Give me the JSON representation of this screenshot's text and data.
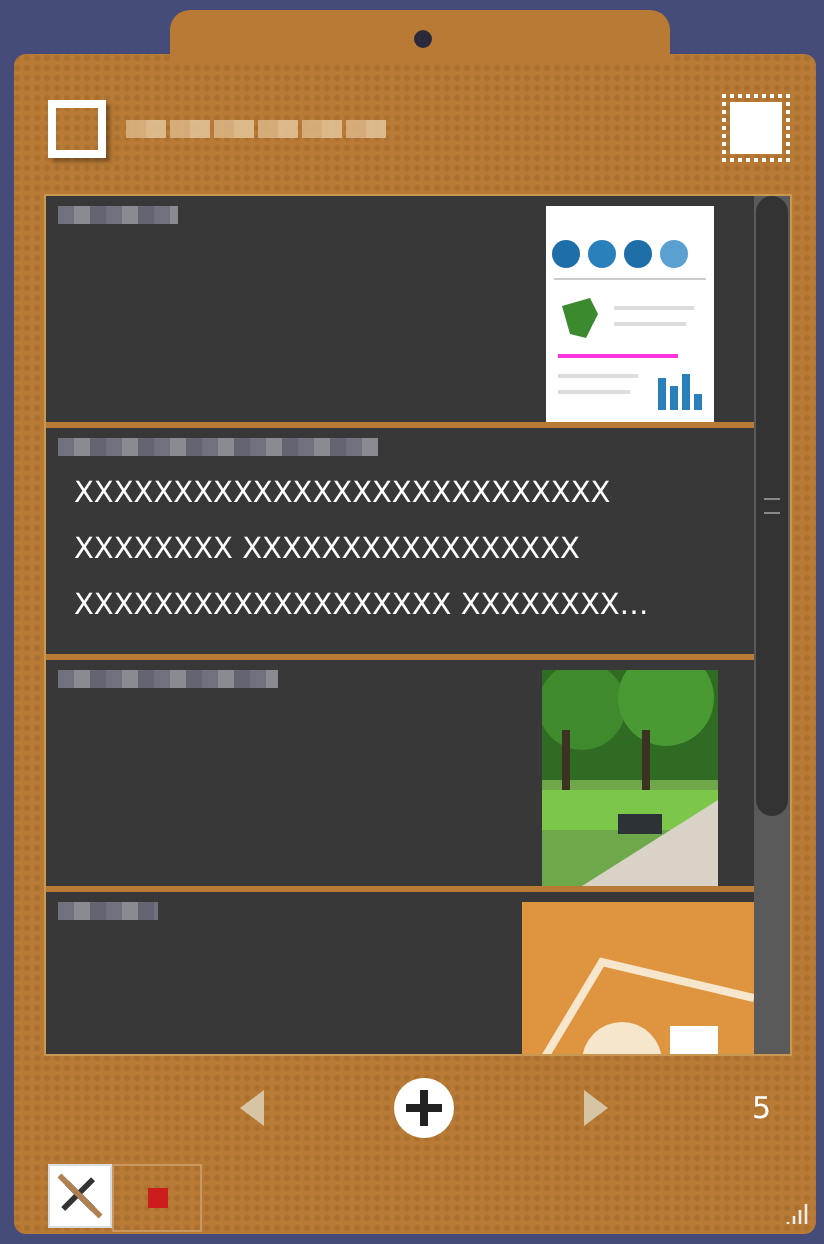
{
  "header": {
    "checkbox": {
      "checked": false
    }
  },
  "notes": [
    {
      "kind": "document"
    },
    {
      "kind": "text",
      "lines": [
        "XXXXXXXXXXXXXXXXXXXXXXXXXXX",
        "XXXXXXXX XXXXXXXXXXXXXXXXX",
        "XXXXXXXXXXXXXXXXXXX XXXXXXXX…"
      ]
    },
    {
      "kind": "picture"
    },
    {
      "kind": "logo"
    }
  ],
  "pager": {
    "count": "5"
  }
}
